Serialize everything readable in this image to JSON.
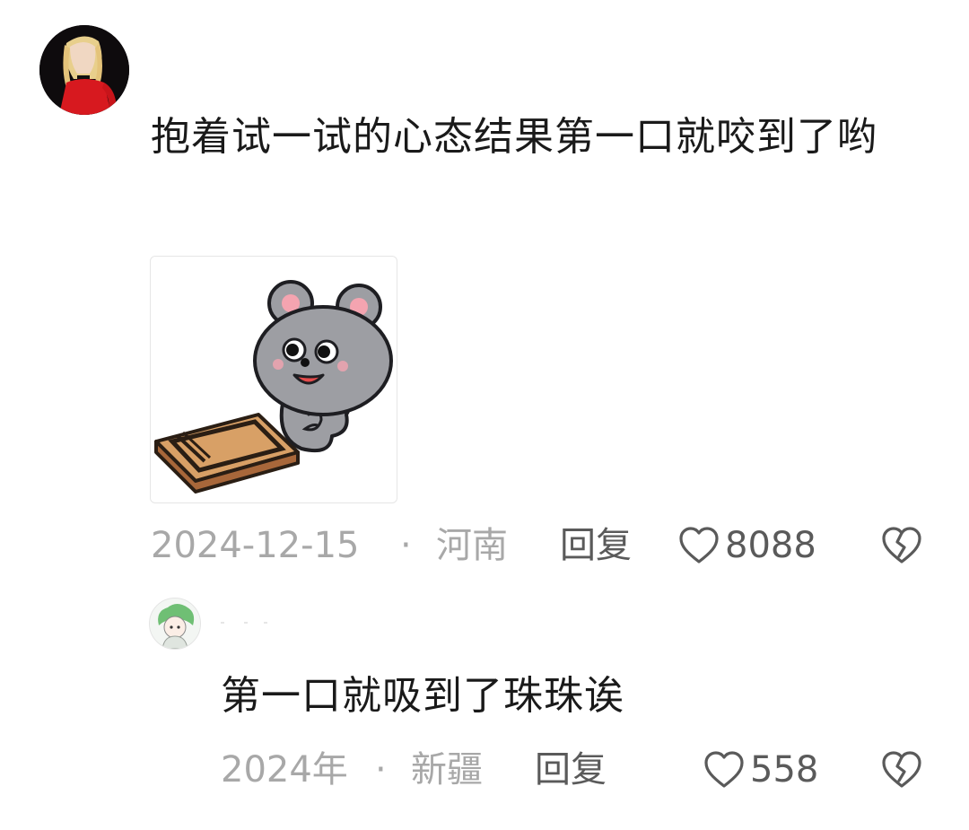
{
  "main_comment": {
    "avatar_icon": "user-avatar",
    "text": "抱着试一试的心态结果第一口就咬到了哟",
    "sticker_icon": "mouse-with-mousetrap-sticker",
    "date": "2024-12-15",
    "separator": "·",
    "location": "河南",
    "reply_label": "回复",
    "like_count": "8088",
    "like_icon": "heart-outline-icon",
    "dislike_icon": "broken-heart-icon"
  },
  "reply_comment": {
    "avatar_icon": "user-avatar",
    "text": "第一口就吸到了珠珠诶",
    "date": "2024年",
    "separator": "·",
    "location": "新疆",
    "reply_label": "回复",
    "like_count": "558",
    "like_icon": "heart-outline-icon",
    "dislike_icon": "broken-heart-icon"
  },
  "colors": {
    "meta_gray": "#a8a8a8",
    "action_gray": "#5a5a5a",
    "text": "#1a1a1a"
  }
}
